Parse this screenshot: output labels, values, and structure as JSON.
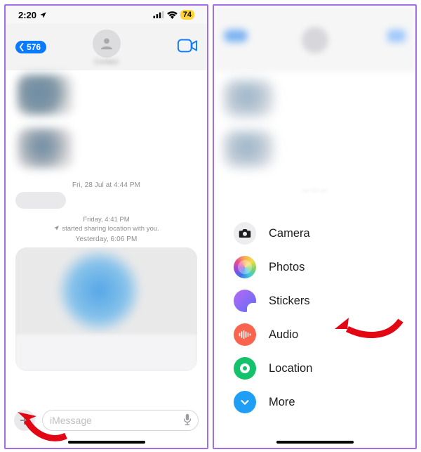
{
  "statusbar": {
    "time": "2:20",
    "battery": "74"
  },
  "nav": {
    "back_count": "576",
    "contact_name": "Contact"
  },
  "timestamps": {
    "ts1": "Fri, 28 Jul at 4:44 PM",
    "ts2": "Friday, 4:41 PM",
    "sys_share": "started sharing location with you.",
    "ts3": "Yesterday, 6:06 PM"
  },
  "composer": {
    "placeholder": "iMessage"
  },
  "menu": {
    "items": [
      {
        "label": "Camera"
      },
      {
        "label": "Photos"
      },
      {
        "label": "Stickers"
      },
      {
        "label": "Audio"
      },
      {
        "label": "Location"
      },
      {
        "label": "More"
      }
    ]
  },
  "colors": {
    "accent_blue": "#0a7aff",
    "audio_orange": "#f8644d",
    "location_green": "#13c26a",
    "more_blue": "#1e9ef4",
    "arrow_red": "#e30613"
  }
}
